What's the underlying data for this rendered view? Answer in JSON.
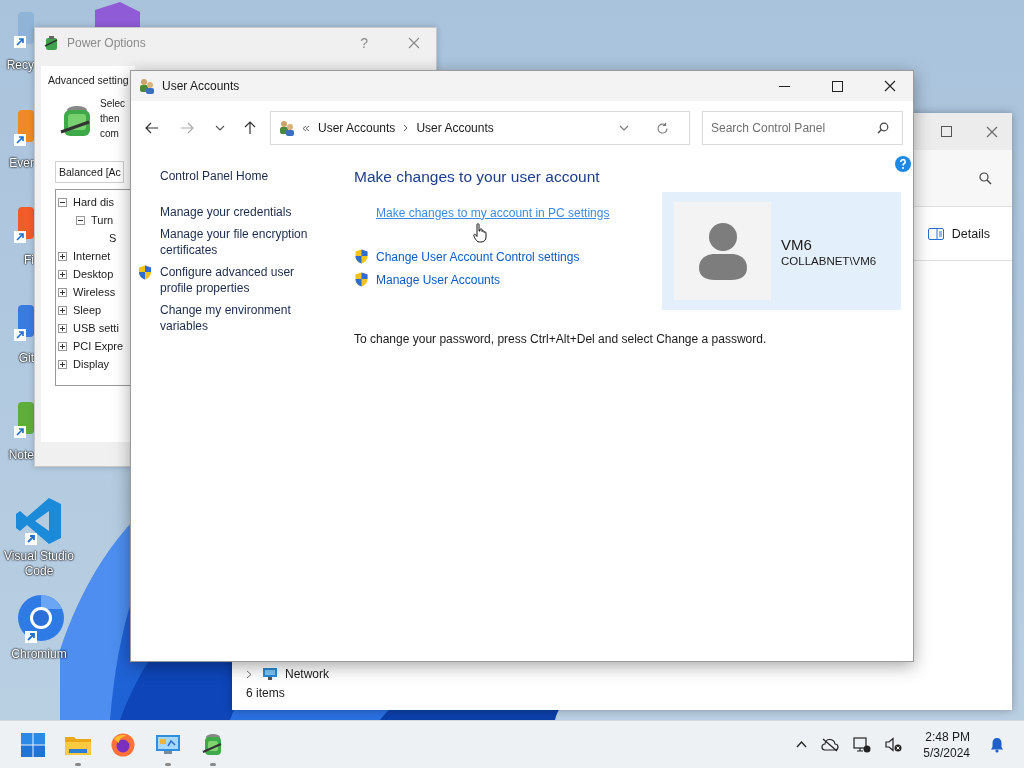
{
  "desktop": {
    "partial_icons": [
      {
        "kind": "bin",
        "label": "Recy"
      },
      {
        "kind": "elephant",
        "label": "Ever"
      },
      {
        "kind": "fox",
        "label": "Fi"
      },
      {
        "kind": "git",
        "label": "Git"
      },
      {
        "kind": "notepad",
        "label": "Note"
      }
    ],
    "icons": [
      {
        "kind": "vscode",
        "label": "Visual Studio Code"
      },
      {
        "kind": "chromium",
        "label": "Chromium"
      }
    ]
  },
  "power_options": {
    "title": "Power Options",
    "help": "?",
    "tab": "Advanced setting",
    "intro_lines": [
      "Selec",
      "then",
      "com"
    ],
    "plan": "Balanced [Ac",
    "tree": [
      {
        "label": "Hard dis",
        "expanded": true,
        "children": [
          {
            "label": "Turn",
            "expanded": true,
            "children": [
              {
                "label": "S"
              }
            ]
          }
        ]
      },
      {
        "label": "Internet",
        "expanded": false
      },
      {
        "label": "Desktop",
        "expanded": false
      },
      {
        "label": "Wireless",
        "expanded": false
      },
      {
        "label": "Sleep",
        "expanded": false
      },
      {
        "label": "USB setti",
        "expanded": false
      },
      {
        "label": "PCI Expre",
        "expanded": false
      },
      {
        "label": "Display",
        "expanded": false
      }
    ]
  },
  "explorer": {
    "details": "Details",
    "nav_item": "Network",
    "status": "6 items"
  },
  "user_accounts": {
    "title": "User Accounts",
    "breadcrumb": [
      "User Accounts",
      "User Accounts"
    ],
    "search": {
      "placeholder": "Search Control Panel"
    },
    "sidebar": [
      {
        "label": "Control Panel Home",
        "shield": false
      },
      {
        "label": "Manage your credentials",
        "shield": false
      },
      {
        "label": "Manage your file encryption certificates",
        "shield": false
      },
      {
        "label": "Configure advanced user profile properties",
        "shield": true
      },
      {
        "label": "Change my environment variables",
        "shield": false
      }
    ],
    "heading": "Make changes to your user account",
    "links": [
      {
        "label": "Make changes to my account in PC settings",
        "shield": false,
        "hovered": true
      },
      {
        "label": "Change User Account Control settings",
        "shield": true,
        "hovered": false
      },
      {
        "label": "Manage User Accounts",
        "shield": true,
        "hovered": false
      }
    ],
    "account": {
      "name": "VM6",
      "domain": "COLLABNET\\VM6"
    },
    "note": "To change your password, press Ctrl+Alt+Del and select Change a password."
  },
  "taskbar": {
    "apps": [
      {
        "kind": "start",
        "running": false
      },
      {
        "kind": "folder",
        "running": true
      },
      {
        "kind": "firefox",
        "running": false
      },
      {
        "kind": "control",
        "running": true
      },
      {
        "kind": "power",
        "running": true
      }
    ],
    "time": "2:48 PM",
    "date": "5/3/2024"
  }
}
